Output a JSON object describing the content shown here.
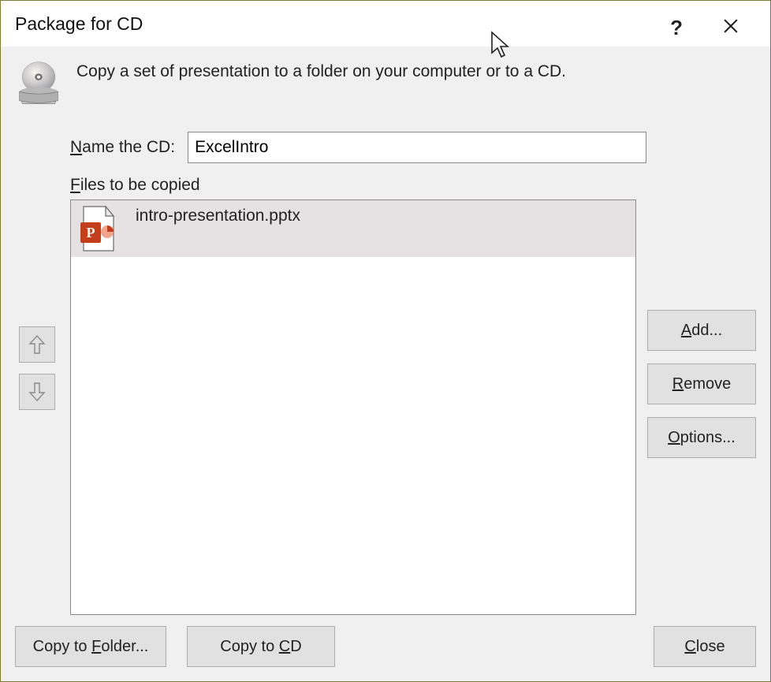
{
  "titlebar": {
    "title": "Package for CD"
  },
  "description": "Copy a set of presentation to a folder on your computer or to a CD.",
  "name_field": {
    "label_prefix": "N",
    "label_rest": "ame the CD:",
    "value": "ExcelIntro"
  },
  "files_section": {
    "label_prefix": "F",
    "label_rest": "iles to be copied",
    "items": [
      {
        "filename": "intro-presentation.pptx"
      }
    ]
  },
  "buttons": {
    "add_prefix": "A",
    "add_rest": "dd...",
    "remove_prefix": "R",
    "remove_rest": "emove",
    "options_prefix": "O",
    "options_rest": "ptions...",
    "copy_folder_pre": "Copy to ",
    "copy_folder_u": "F",
    "copy_folder_rest": "older...",
    "copy_cd_pre": "Copy to ",
    "copy_cd_u": "C",
    "copy_cd_rest": "D",
    "close_u": "C",
    "close_rest": "lose"
  }
}
